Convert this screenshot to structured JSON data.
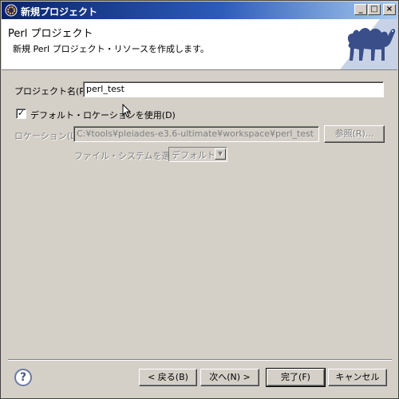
{
  "window": {
    "title": "新規プロジェクト"
  },
  "banner": {
    "title": "Perl プロジェクト",
    "description": "新規 Perl プロジェクト・リソースを作成します。"
  },
  "form": {
    "project_name_label": "プロジェクト名(P):",
    "project_name_value": "perl_test",
    "use_default_location_label": "デフォルト・ロケーションを使用(D)",
    "use_default_location_checked": true,
    "location_label": "ロケーション(L):",
    "location_value": "C:¥tools¥pleiades-e3.6-ultimate¥workspace¥perl_test",
    "browse_label": "参照(R)...",
    "filesystem_label": "ファイル・システムを選択:",
    "filesystem_value": "デフォルト"
  },
  "buttons": {
    "back": "< 戻る(B)",
    "next": "次へ(N) >",
    "finish": "完了(F)",
    "cancel": "キャンセル"
  },
  "titlebar_buttons": {
    "minimize": "_",
    "maximize": "□",
    "close": "×"
  }
}
